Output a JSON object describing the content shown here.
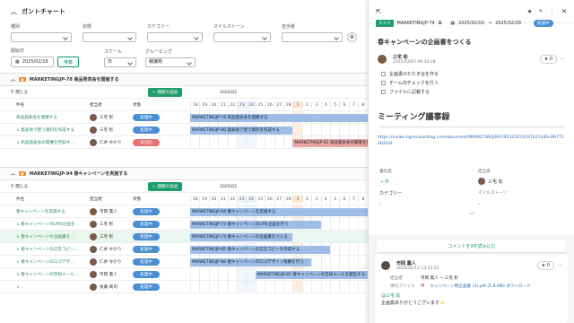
{
  "gantt": {
    "title": "ガントチャート",
    "filters": [
      {
        "label": "種別",
        "width": 68
      },
      {
        "label": "状態",
        "width": 60
      },
      {
        "label": "カテゴリー",
        "width": 62
      },
      {
        "label": "マイルストーン",
        "width": 64
      },
      {
        "label": "担当者",
        "width": 68
      }
    ],
    "start_label": "開始日",
    "start_date": "2025/02/18",
    "today_label": "今日",
    "scale_label": "スケール",
    "scale_value": "日",
    "grouping_label": "グルーピング",
    "grouping_value": "親課題",
    "month_label": "2025/02",
    "days": [
      "18",
      "19",
      "20",
      "21",
      "22",
      "23",
      "24",
      "25",
      "26",
      "27",
      "28",
      "1",
      "2",
      "3",
      "4",
      "5",
      "6",
      "7",
      "8"
    ],
    "columns": {
      "name": "件名",
      "assignee": "担当者",
      "status": "状態"
    },
    "collapse_label": "閉じる",
    "add_button": "+ 課題の追加",
    "groups": [
      {
        "key": "MARKETINGJP-78",
        "title": "MARKETINGJP-78 商品発表会を開催する",
        "rows": [
          {
            "name": "商品発表会を開催する",
            "child": false,
            "assignee": "三宅 彰",
            "status": "処理中",
            "status_type": "proc",
            "bar": "MARKETINGJP-78 商品発表会を開催する",
            "bar_start": 0,
            "bar_len": 19,
            "bar_color": "blue"
          },
          {
            "name": "↳ 発表会で使う資料を作成する",
            "child": true,
            "assignee": "三宅 彰",
            "status": "処理中",
            "status_type": "proc",
            "bar": "MARKETINGJP-80 発表会で使う資料を作成する",
            "bar_start": 0,
            "bar_len": 11,
            "bar_color": "blue"
          },
          {
            "name": "↳ 商品発表会の開催を告知す…",
            "child": true,
            "assignee": "仁井 ゆかり",
            "status": "未対応",
            "status_type": "todo",
            "bar": "MARKETINGJP-81 商品発表会の開催を告知する",
            "bar_start": 11,
            "bar_len": 8,
            "bar_color": "red"
          }
        ]
      },
      {
        "key": "MARKETINGJP-94",
        "title": "MARKETINGJP-94 春キャンペーンを実施する",
        "rows": [
          {
            "name": "春キャンペーンを実施する",
            "child": false,
            "assignee": "市岡 薫人",
            "status": "処理中",
            "status_type": "proc",
            "bar": "MARKETINGJP-94 春キャンペーンを実施する",
            "bar_start": 0,
            "bar_len": 19,
            "bar_color": "blue"
          },
          {
            "name": "↳ 春キャンペーンのLPの企画を…",
            "child": true,
            "assignee": "三宅 彰",
            "status": "処理中",
            "status_type": "proc",
            "bar": "MARKETINGJP-73 春キャンペーンのLPの企画を行う",
            "bar_start": 0,
            "bar_len": 14,
            "bar_color": "blue"
          },
          {
            "name": "↳ 春キャンペーンの企画書を…",
            "child": true,
            "assignee": "三宅 彰",
            "status": "処理中",
            "status_type": "proc",
            "bar": "MARKETINGJP-74 春キャンペーンの企画書をつくる",
            "bar_start": 0,
            "bar_len": 11,
            "bar_color": "blue"
          },
          {
            "name": "↳ 春キャンペーンの広告コピー…",
            "child": true,
            "assignee": "仁井 ゆかり",
            "status": "処理中",
            "status_type": "proc",
            "bar": "MARKETINGJP-85 春キャンペーンの広告コピーを作成する",
            "bar_start": 0,
            "bar_len": 15,
            "bar_color": "blue"
          },
          {
            "name": "↳ 春キャンペーンのロゴデザ…",
            "child": true,
            "assignee": "仁井 ゆかり",
            "status": "処理中",
            "status_type": "proc",
            "bar": "MARKETINGJP-86 春キャンペーンのロゴデザイン依頼を行う",
            "bar_start": 0,
            "bar_len": 13,
            "bar_color": "blue"
          },
          {
            "name": "↳ 春キャンペーンの告知メール…",
            "child": true,
            "assignee": "市岡 薫人",
            "status": "処理中",
            "status_type": "proc",
            "bar": "MARKETINGJP-87 春キャンペーンの告知メールを配信する",
            "bar_start": 7,
            "bar_len": 12,
            "bar_color": "blue"
          },
          {
            "name": "↳ …",
            "child": true,
            "assignee": "後藤 真司",
            "status": "処理中",
            "status_type": "proc",
            "bar": "",
            "bar_start": 0,
            "bar_len": 0,
            "bar_color": "blue"
          }
        ]
      }
    ]
  },
  "detail": {
    "task_tag": "タスク",
    "key": "MARKETINGJP-74",
    "start": "2025/02/03",
    "arrow": "→",
    "due": "2025/02/28",
    "status": "処理中",
    "title": "春キャンペーンの企画書をつくる",
    "author": "三宅 彰",
    "created": "2025/02/07 09:30:28",
    "star_count": "0",
    "checklist": [
      "企画書のたたき台を作る",
      "チーム内チェックを行う",
      "ファイルに記載する"
    ],
    "heading": "ミーティング議事録",
    "url": "https://nulab-sigma.backlog.com/document/MARKETINGJP/0192322674197b27a4fa3fb77140203f",
    "priority_label": "優先度",
    "priority_value": "→ 中",
    "assignee_label": "担当者",
    "assignee_value": "三宅 彰",
    "category_label": "カテゴリー",
    "category_value": "-",
    "milestone_label": "マイルストーン",
    "milestone_value": "-",
    "load_comments": "コメントを9件読み込む",
    "comment": {
      "author": "市岡 薫人",
      "time": "2025/02/12 14:33:55",
      "star_count": "0",
      "assignee_label": "担当者",
      "assignee_change": "市岡 薫人 → 三宅 彰",
      "file_label": "添付ファイル",
      "file_value": "キャンペーン用企画書 (3).pdf (5.8 MB) ダウンロード",
      "mention": "@三宅 彰",
      "body": "企画案ありがとうございます✨"
    }
  },
  "colors": {
    "accent": "#1e9e6e",
    "processing": "#4a8fd4",
    "todo": "#e57373",
    "bar_blue": "#9dbde6",
    "bar_red": "#e8a6a6"
  }
}
